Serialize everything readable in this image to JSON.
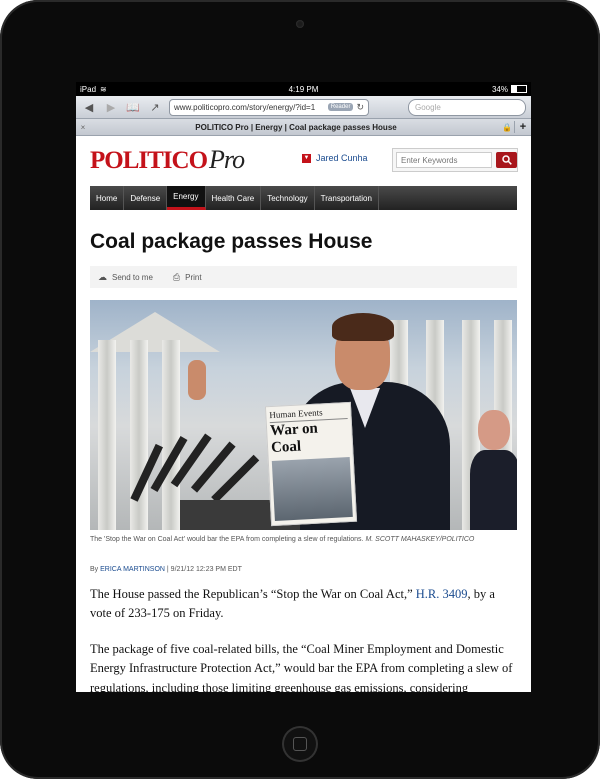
{
  "status_bar": {
    "device": "iPad",
    "time": "4:19 PM",
    "battery": "34%",
    "battery_level": 0.34
  },
  "browser": {
    "url": "www.politicopro.com/story/energy/?id=1",
    "reader_label": "Reader",
    "search_placeholder": "Google",
    "tab_title": "POLITICO Pro | Energy | Coal package passes House"
  },
  "site": {
    "logo_main": "POLITICO",
    "logo_pro": "Pro",
    "user_name": "Jared Cunha",
    "keyword_placeholder": "Enter Keywords",
    "nav": [
      "Home",
      "Defense",
      "Energy",
      "Health Care",
      "Technology",
      "Transportation"
    ],
    "nav_active": "Energy"
  },
  "article": {
    "headline": "Coal package passes House",
    "send_label": "Send to me",
    "print_label": "Print",
    "photo_paper_title": "Human Events",
    "photo_paper_headline": "War on Coal",
    "caption": "The 'Stop the War on Coal Act' would bar the EPA from completing a slew of regulations.",
    "credit": "M. SCOTT MAHASKEY/POLITICO",
    "byline_prefix": "By",
    "author": "ERICA MARTINSON",
    "date": "| 9/21/12 12:23 PM EDT",
    "p1_a": "The House passed the Republican’s “Stop the War on Coal Act,”",
    "p1_link": "H.R. 3409",
    "p1_b": ", by a vote of 233-175 on Friday.",
    "p2": "The package of five coal-related bills, the “Coal Miner Employment and Domestic Energy Infrastructure Protection Act,” would bar the EPA from completing a slew of regulations, including those limiting greenhouse gas emissions, considering"
  }
}
